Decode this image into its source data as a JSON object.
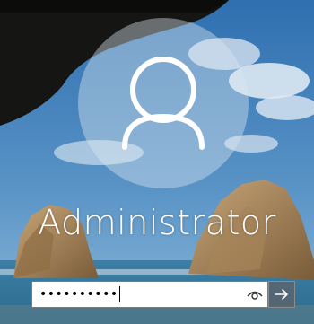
{
  "login": {
    "username": "Administrator",
    "password_mask": "••••••••••"
  },
  "icons": {
    "avatar": "user-silhouette-icon",
    "reveal": "eye-icon",
    "submit": "arrow-right-icon"
  },
  "colors": {
    "avatar_circle": "#dce6f0",
    "submit_bg": "#5a646e"
  }
}
